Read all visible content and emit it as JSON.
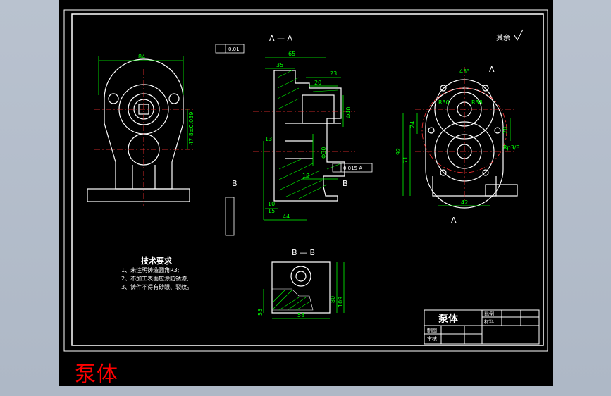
{
  "caption": "泵体",
  "views": {
    "section_aa": "A — A",
    "section_bb": "B — B",
    "cut_a": "A",
    "cut_b": "B"
  },
  "roughness_note": "其余",
  "tech_req": {
    "title": "技术要求",
    "items": [
      "1、未注明铸造圆角R3;",
      "2、不加工表面应涂防锈漆;",
      "3、铸件不得有砂眼、裂纹。"
    ]
  },
  "title_block": {
    "part_name": "泵体",
    "scale_label": "比例",
    "material_label": "材料",
    "draw_label": "制图",
    "review_label": "审核"
  },
  "dims": {
    "w84": "84",
    "h_left": "47.8±0.039",
    "w65": "65",
    "w35": "35",
    "w23": "23",
    "w20": "20",
    "d40": "Φ40",
    "d30": "Φ30",
    "w13": "13",
    "w18": "18",
    "w10": "10",
    "w15": "15",
    "w44": "44",
    "tol1": "0.015 A",
    "flat": "0.01",
    "a45": "45°",
    "r30": "R30",
    "r38": "R38",
    "d92": "92",
    "d71": "71",
    "d42": "42",
    "d20": "20",
    "d24": "24",
    "w58": "58",
    "h80": "80",
    "h109": "109",
    "h55": "55",
    "thread": "Rp3/8"
  }
}
